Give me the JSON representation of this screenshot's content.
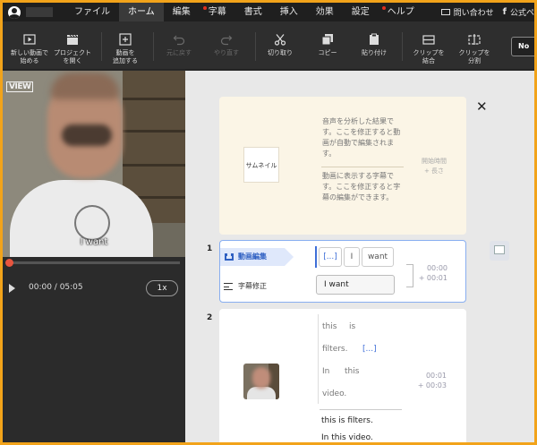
{
  "menubar": {
    "items": [
      {
        "label": "ファイル",
        "active": false,
        "dot": false
      },
      {
        "label": "ホーム",
        "active": true,
        "dot": false
      },
      {
        "label": "編集",
        "active": false,
        "dot": false
      },
      {
        "label": "字幕",
        "active": false,
        "dot": true
      },
      {
        "label": "書式",
        "active": false,
        "dot": false
      },
      {
        "label": "挿入",
        "active": false,
        "dot": false
      },
      {
        "label": "効果",
        "active": false,
        "dot": false
      },
      {
        "label": "設定",
        "active": false,
        "dot": false
      },
      {
        "label": "ヘルプ",
        "active": false,
        "dot": true
      }
    ],
    "contact": "問い合わせ",
    "official": "公式ペ"
  },
  "toolbar": {
    "new_video": [
      "新しい動画で",
      "始める"
    ],
    "open_project": [
      "プロジェクト",
      "を開く"
    ],
    "add_video": [
      "動画を",
      "追加する"
    ],
    "undo": [
      "元に戻す"
    ],
    "redo": [
      "やり直す"
    ],
    "cut": [
      "切り取り"
    ],
    "copy": [
      "コピー"
    ],
    "paste": [
      "貼り付け"
    ],
    "merge_clip": [
      "クリップを",
      "結合"
    ],
    "split_clip": [
      "クリップを",
      "分割"
    ],
    "no_button": "No"
  },
  "video": {
    "caption": "I want",
    "logo": "VIEW",
    "progress": 0,
    "time": "00:00 / 05:05",
    "speed": "1x"
  },
  "help_card": {
    "thumbnail": "サムネイル",
    "audio_text": "音声を分析した結果です。ここを修正すると動画が自動で編集されます。",
    "subtitle_text": "動画に表示する字幕です。ここを修正すると字幕の編集ができます。",
    "time_label": "開始時間",
    "length_label": "+ 長さ"
  },
  "clips": [
    {
      "number": "1",
      "video_tag": "動画編集",
      "subtitle_tag": "字幕修正",
      "words": [
        "[...]",
        "I",
        "want"
      ],
      "subtitle": "I want",
      "start": "00:00",
      "length": "+ 00:01"
    },
    {
      "number": "2",
      "words_line1": [
        "this",
        "is"
      ],
      "words_line2": [
        "filters.",
        "[...]"
      ],
      "words_line3": [
        "In",
        "this"
      ],
      "words_line4": [
        "video."
      ],
      "subtitle_line1": "this is filters.",
      "subtitle_line2": "In this video.",
      "start": "00:01",
      "length": "+ 00:03"
    }
  ]
}
